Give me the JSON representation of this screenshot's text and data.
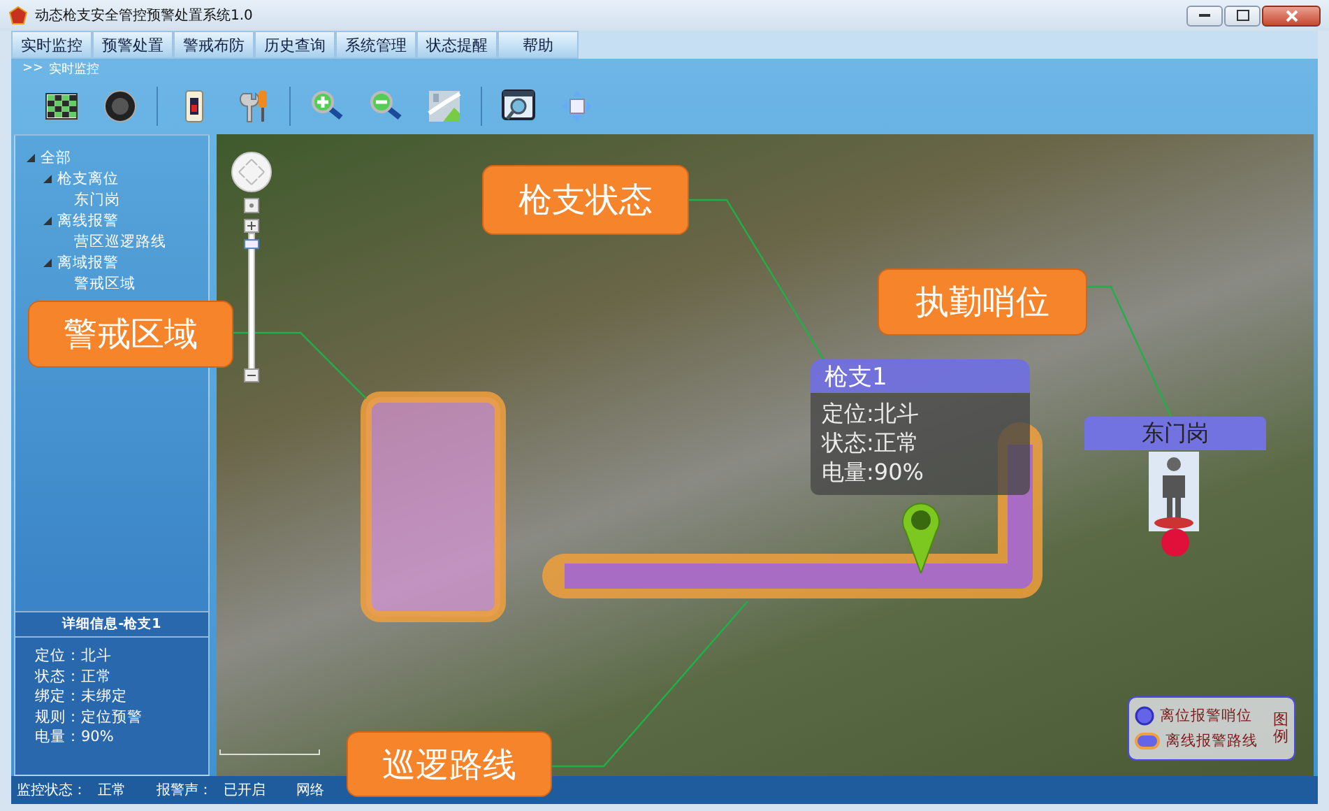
{
  "window": {
    "title": "动态枪支安全管控预警处置系统1.0"
  },
  "menu": [
    "实时监控",
    "预警处置",
    "警戒布防",
    "历史查询",
    "系统管理",
    "状态提醒",
    "帮助"
  ],
  "breadcrumb": {
    "marker": ">>",
    "label": "实时监控"
  },
  "tree": [
    {
      "label": "全部",
      "expanded": true,
      "children": [
        {
          "label": "枪支离位",
          "expanded": true,
          "children": [
            {
              "label": "东门岗"
            }
          ]
        },
        {
          "label": "离线报警",
          "expanded": true,
          "children": [
            {
              "label": "营区巡逻路线"
            }
          ]
        },
        {
          "label": "离域报警",
          "expanded": true,
          "children": [
            {
              "label": "警戒区域"
            }
          ]
        }
      ]
    }
  ],
  "details": {
    "title": "详细信息-枪支1",
    "lines": [
      "定位：北斗",
      "状态：正常",
      "绑定：未绑定",
      "规则：定位预警",
      "电量：90%"
    ]
  },
  "map": {
    "callouts": [
      {
        "label": "枪支状态"
      },
      {
        "label": "执勤哨位"
      },
      {
        "label": "警戒区域"
      },
      {
        "label": "巡逻路线"
      }
    ],
    "zoom_slider": {
      "level": 0.95
    },
    "popup": {
      "title": "枪支1",
      "lines": [
        "定位:北斗",
        "状态:正常",
        "电量:90%"
      ]
    },
    "post": {
      "label": "东门岗"
    },
    "legend": {
      "title": "图例",
      "items": [
        {
          "kind": "dot",
          "label": "离位报警哨位"
        },
        {
          "kind": "route",
          "label": "离线报警路线"
        }
      ]
    }
  },
  "status_bar": [
    {
      "label": "监控状态：",
      "value": "正常"
    },
    {
      "label": "报警声：",
      "value": "已开启"
    },
    {
      "label": "网络"
    }
  ]
}
